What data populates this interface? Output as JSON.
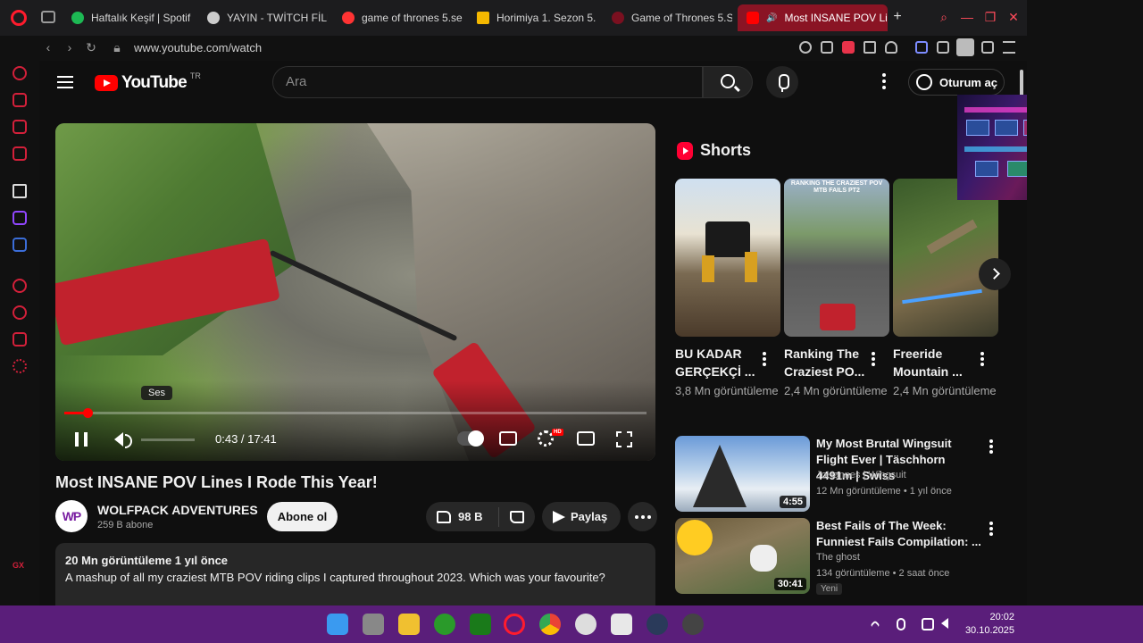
{
  "browser": {
    "tabs": [
      {
        "label": "Haftalık Keşif | Spotif",
        "favicon_color": "#1db954"
      },
      {
        "label": "YAYIN - TWİTCH FİLM",
        "favicon_color": "#cccccc"
      },
      {
        "label": "game of thrones 5.se",
        "favicon_color": "#ff3333"
      },
      {
        "label": "Horimiya 1. Sezon 5.",
        "favicon_color": "#f5b800"
      },
      {
        "label": "Game of Thrones 5.S",
        "favicon_color": "#7a1020"
      },
      {
        "label": "Most INSANE POV Lin",
        "favicon_color": "#ff0000"
      }
    ],
    "url": "www.youtube.com/watch",
    "new_tab": "+"
  },
  "youtube": {
    "logo_text": "YouTube",
    "country_code": "TR",
    "search_placeholder": "Ara",
    "signin_label": "Oturum aç"
  },
  "player": {
    "tooltip": "Ses",
    "current_time": "0:43",
    "duration": "17:41",
    "timecode": "0:43 / 17:41",
    "progress_fraction": 0.0405,
    "volume_fraction": 0.0,
    "hd_badge": "HD"
  },
  "video": {
    "title": "Most INSANE POV Lines I Rode This Year!",
    "channel_initials": "WP",
    "channel_name": "WOLFPACK ADVENTURES",
    "subscribers": "259 B abone",
    "subscribe_label": "Abone ol",
    "likes": "98 B",
    "share_label": "Paylaş",
    "description_stats": "20 Mn görüntüleme  1 yıl önce",
    "description_text": "A mashup of all my craziest MTB POV riding clips I captured throughout 2023. Which was your favourite?"
  },
  "shorts": {
    "heading": "Shorts",
    "items": [
      {
        "title": "BU KADAR GERÇEKÇİ ...",
        "views": "3,8 Mn görüntüleme"
      },
      {
        "title": "Ranking The Craziest PO...",
        "views": "2,4 Mn görüntüleme",
        "overlay_text": "RANKING THE CRAZIEST POV MTB FAILS PT2"
      },
      {
        "title": "Freeride Mountain ...",
        "views": "2,4 Mn görüntüleme"
      }
    ]
  },
  "related": [
    {
      "title": "My Most Brutal Wingsuit Flight Ever | Täschhorn 4491m | Swiss",
      "channel": "JoHannes | Wingsuit",
      "meta": "12 Mn görüntüleme • 1 yıl önce",
      "duration": "4:55"
    },
    {
      "title": "Best Fails of The Week: Funniest Fails Compilation: ...",
      "channel": "The ghost",
      "meta": "134 görüntüleme • 2 saat önce",
      "duration": "30:41",
      "badge": "Yeni"
    }
  ],
  "taskbar": {
    "time": "20:02",
    "date": "30.10.2025"
  }
}
